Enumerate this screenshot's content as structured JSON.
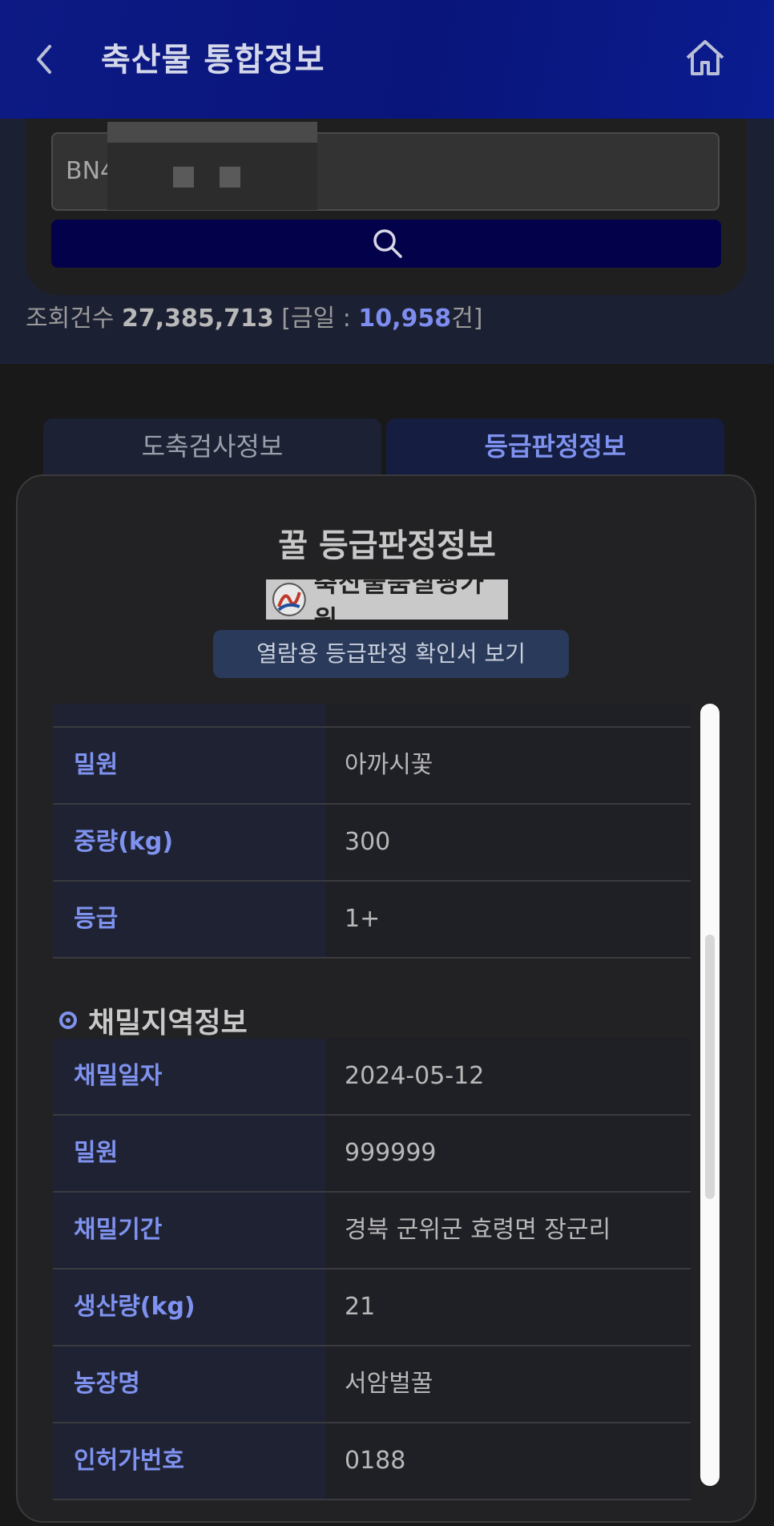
{
  "header": {
    "title": "축산물 통합정보",
    "back_icon": "chevron-left-icon",
    "home_icon": "home-icon"
  },
  "search": {
    "value": "BN4",
    "button_icon": "search-icon"
  },
  "stats": {
    "label": "조회건수",
    "total": "27,385,713",
    "open_bracket": "[금일 :",
    "today": "10,958",
    "suffix": "건]"
  },
  "tabs": [
    {
      "label": "도축검사정보",
      "active": false
    },
    {
      "label": "등급판정정보",
      "active": true
    }
  ],
  "panel": {
    "title": "꿀 등급판정정보",
    "logo_text": "축산물품질평가원",
    "view_button": "열람용 등급판정 확인서 보기"
  },
  "grade_rows": [
    {
      "label": "밀원",
      "value": "아까시꽃"
    },
    {
      "label": "중량(kg)",
      "value": "300"
    },
    {
      "label": "등급",
      "value": "1+"
    }
  ],
  "region_section": {
    "title": "채밀지역정보",
    "rows": [
      {
        "label": "채밀일자",
        "value": "2024-05-12"
      },
      {
        "label": "밀원",
        "value": "999999"
      },
      {
        "label": "채밀기간",
        "value": "경북 군위군 효령면 장군리"
      },
      {
        "label": "생산량(kg)",
        "value": "21"
      },
      {
        "label": "농장명",
        "value": "서암벌꿀"
      },
      {
        "label": "인허가번호",
        "value": "0188"
      }
    ]
  },
  "colors": {
    "header": "#0d1a85",
    "accent": "#7f92ef",
    "panel": "#222224"
  }
}
